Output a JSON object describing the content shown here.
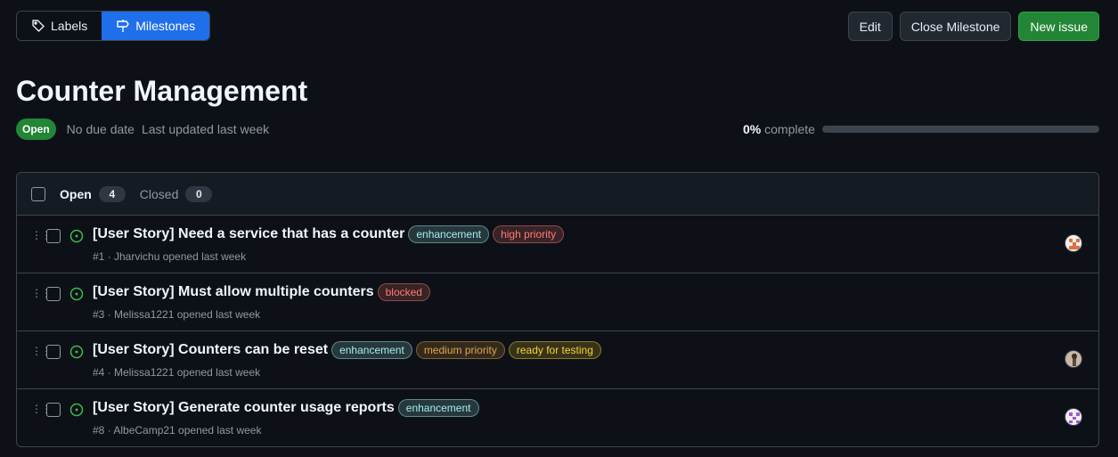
{
  "nav": {
    "labels": {
      "label": "Labels",
      "icon": "tag-icon"
    },
    "milestones": {
      "label": "Milestones",
      "icon": "milestone-icon"
    }
  },
  "actions": {
    "edit": "Edit",
    "close_milestone": "Close Milestone",
    "new_issue": "New issue"
  },
  "milestone": {
    "title": "Counter Management",
    "state": "Open",
    "due": "No due date",
    "updated": "Last updated last week",
    "progress_percent_text": "0%",
    "progress_suffix": "complete",
    "progress_fraction": 0
  },
  "tabs": {
    "open_label": "Open",
    "open_count": "4",
    "closed_label": "Closed",
    "closed_count": "0"
  },
  "colors": {
    "accent": "#1f6feb",
    "success": "#238636",
    "open_icon": "#3fb950"
  },
  "issues": [
    {
      "title": "[User Story] Need a service that has a counter",
      "labels": [
        {
          "text": "enhancement",
          "color": "#a2eeef"
        },
        {
          "text": "high priority",
          "color": "#ff7b72"
        }
      ],
      "meta": "#1 · Jharvichu opened last week",
      "avatar": "avatar-orange"
    },
    {
      "title": "[User Story] Must allow multiple counters",
      "labels": [
        {
          "text": "blocked",
          "color": "#ff7b72"
        }
      ],
      "meta": "#3 · Melissa1221 opened last week",
      "avatar": ""
    },
    {
      "title": "[User Story] Counters can be reset",
      "labels": [
        {
          "text": "enhancement",
          "color": "#a2eeef"
        },
        {
          "text": "medium priority",
          "color": "#e3a344"
        },
        {
          "text": "ready for testing",
          "color": "#f7d232"
        }
      ],
      "meta": "#4 · Melissa1221 opened last week",
      "avatar": "avatar-photo"
    },
    {
      "title": "[User Story] Generate counter usage reports",
      "labels": [
        {
          "text": "enhancement",
          "color": "#a2eeef"
        }
      ],
      "meta": "#8 · AlbeCamp21 opened last week",
      "avatar": "avatar-purple"
    }
  ]
}
